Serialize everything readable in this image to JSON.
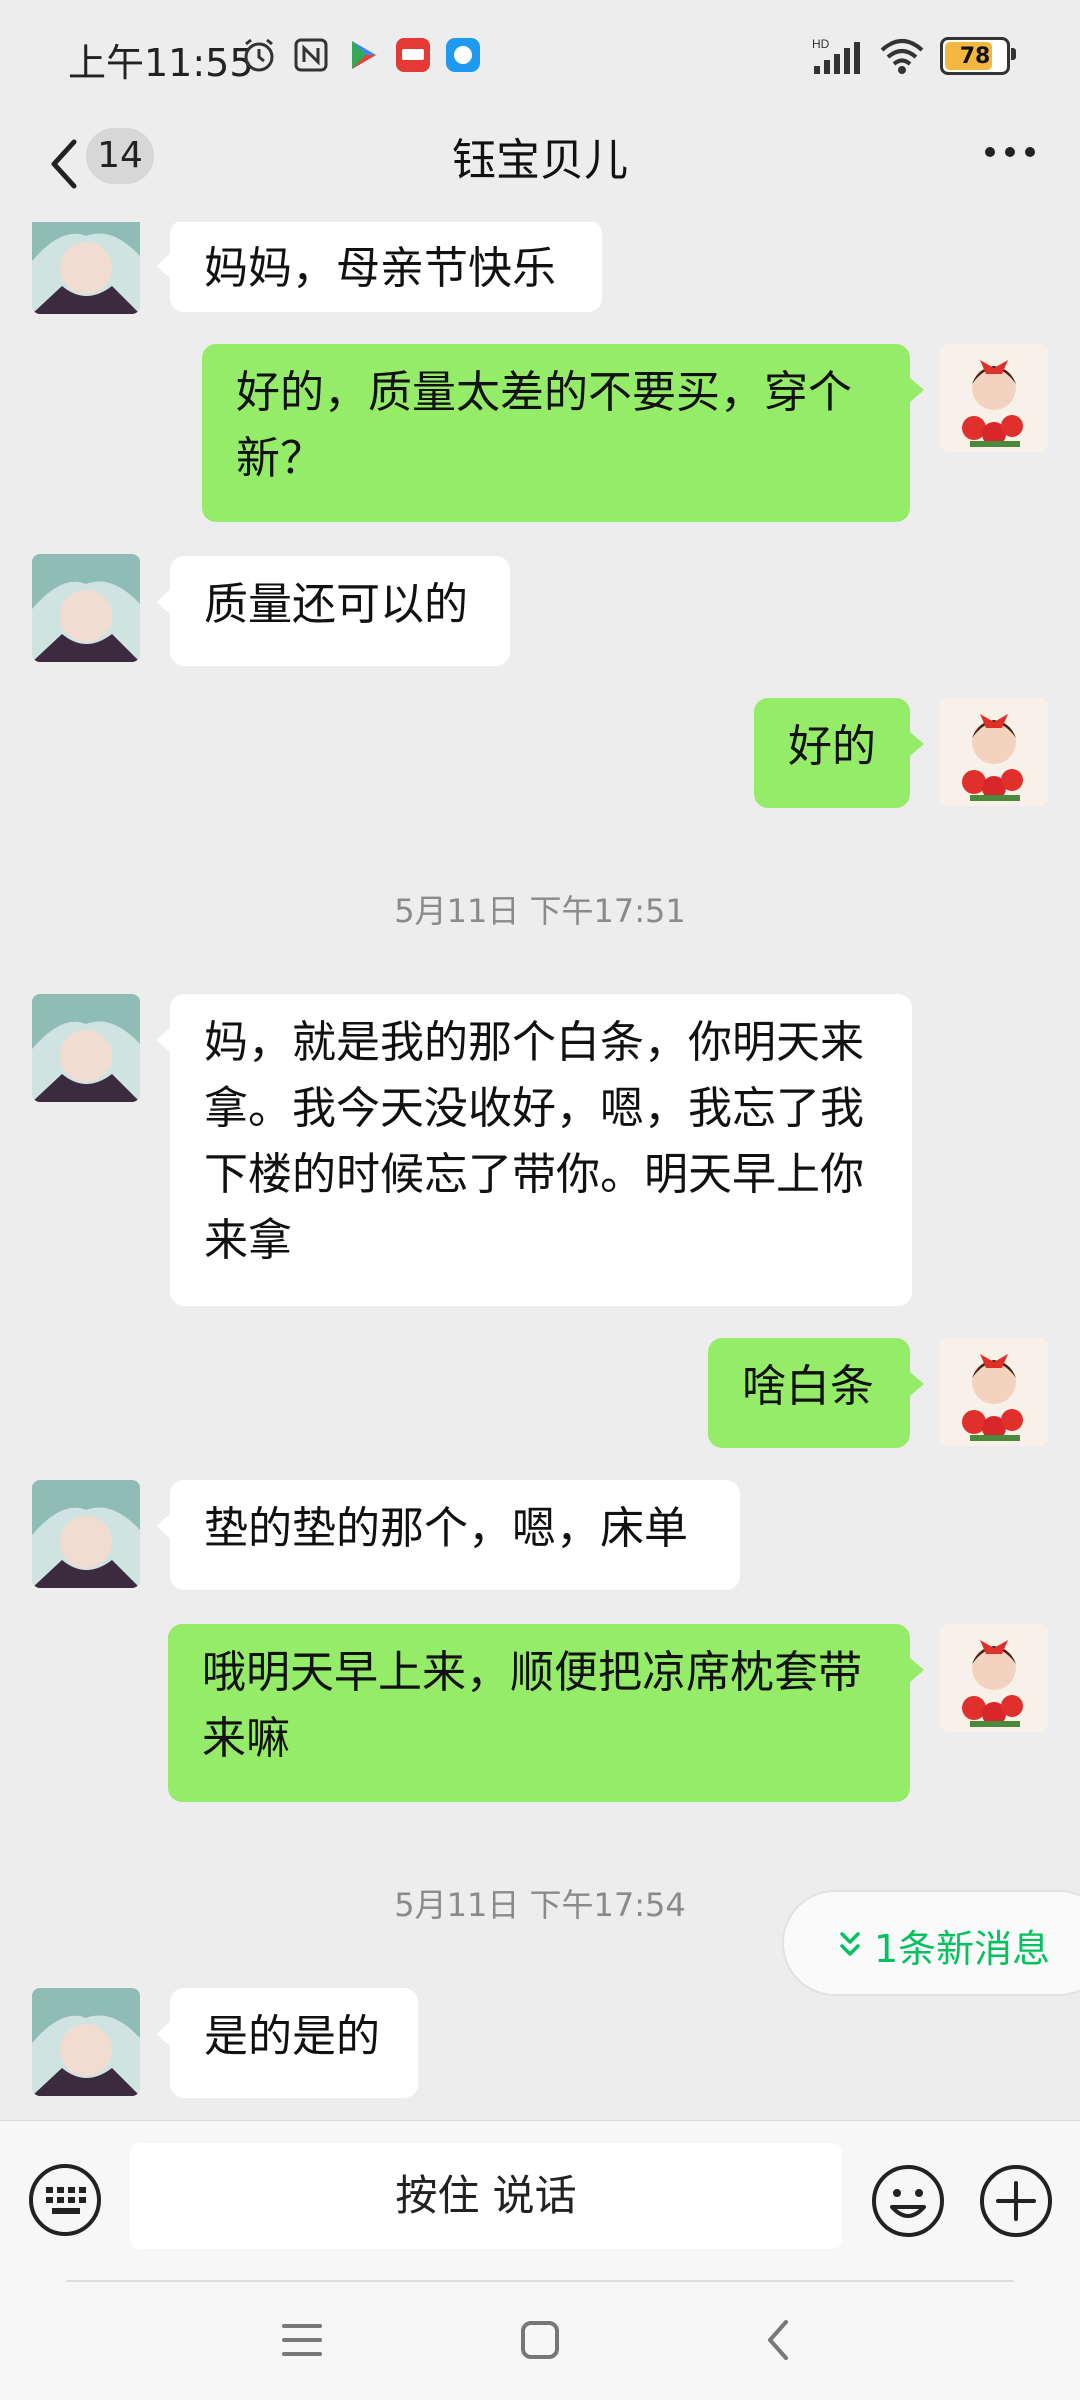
{
  "status_bar": {
    "time": "上午11:55",
    "battery": "78",
    "network_label": "HD"
  },
  "header": {
    "back_count": "14",
    "title": "钰宝贝儿"
  },
  "messages": [
    {
      "side": "in",
      "text": "妈妈，母亲节快乐"
    },
    {
      "side": "out",
      "text": "好的，质量太差的不要买，穿个\n新？"
    },
    {
      "side": "in",
      "text": "质量还可以的"
    },
    {
      "side": "out",
      "text": "好的"
    },
    {
      "side": "time",
      "text": "5月11日 下午17:51"
    },
    {
      "side": "in",
      "text": "妈，就是我的那个白条，你明天来\n拿。我今天没收好，嗯，我忘了我\n下楼的时候忘了带你。明天早上你\n来拿"
    },
    {
      "side": "out",
      "text": "啥白条"
    },
    {
      "side": "in",
      "text": "垫的垫的那个，嗯，床单"
    },
    {
      "side": "out",
      "text": "哦明天早上来，顺便把凉席枕套带\n来嘛"
    },
    {
      "side": "time",
      "text": "5月11日 下午17:54"
    },
    {
      "side": "in",
      "text": "是的是的"
    }
  ],
  "new_message_pill": {
    "label": "1条新消息"
  },
  "input_bar": {
    "voice_label": "按住 说话"
  },
  "colors": {
    "out_bubble": "#95ec69",
    "in_bubble": "#ffffff",
    "accent": "#07c160",
    "background": "#ededed"
  }
}
